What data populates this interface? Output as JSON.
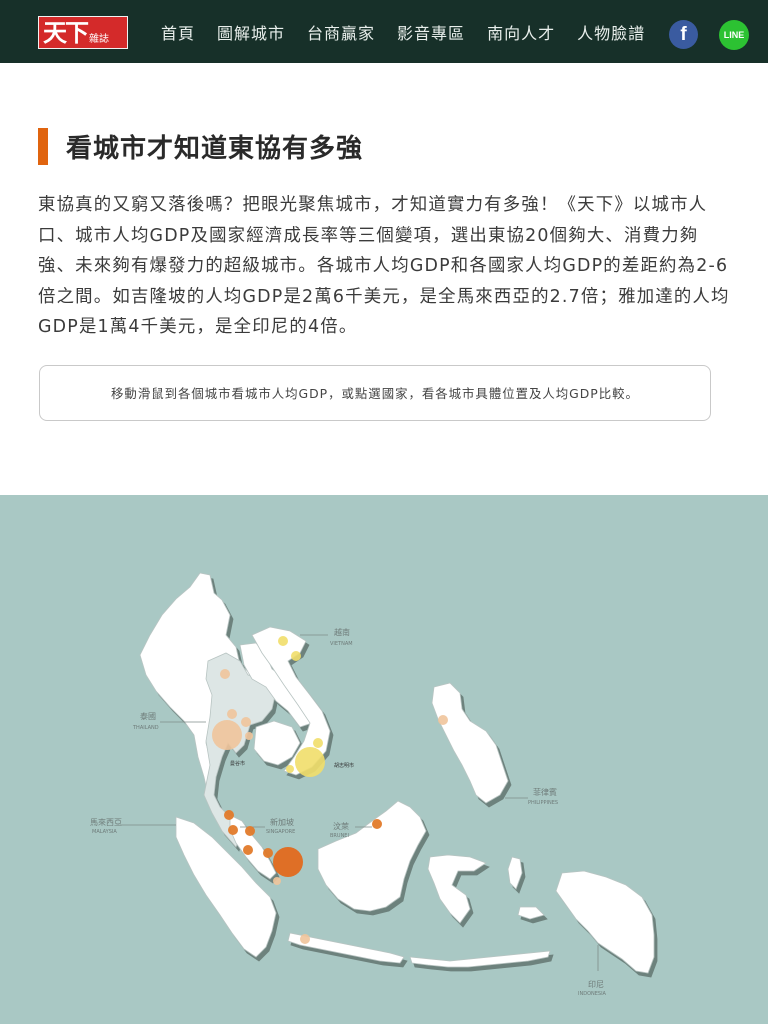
{
  "header": {
    "logo_text": "天下",
    "logo_sub": "雜誌",
    "nav": [
      "首頁",
      "圖解城市",
      "台商贏家",
      "影音專區",
      "南向人才",
      "人物臉譜"
    ],
    "facebook_glyph": "f",
    "line_label": "LINE",
    "icons": [
      "facebook-icon",
      "line-icon"
    ],
    "background_color": "#173029"
  },
  "article": {
    "title": "看城市才知道東協有多強",
    "intro": "東協真的又窮又落後嗎？把眼光聚焦城市，才知道實力有多強！《天下》以城市人口、城市人均GDP及國家經濟成長率等三個變項，選出東協20個夠大、消費力夠強、未來夠有爆發力的超級城市。各城市人均GDP和各國家人均GDP的差距約為2-6倍之間。如吉隆坡的人均GDP是2萬6千美元，是全馬來西亞的2.7倍；雅加達的人均GDP是1萬4千美元，是全印尼的4倍。",
    "hint": "移動滑鼠到各個城市看城市人均GDP，或點選國家，看各城市具體位置及人均GDP比較。",
    "accent_color": "#e0640f"
  },
  "map": {
    "background_color": "#a9c8c4",
    "countries": [
      {
        "name": "越南",
        "en": "VIETNAM"
      },
      {
        "name": "泰國",
        "en": "THAILAND"
      },
      {
        "name": "菲律賓",
        "en": "PHILIPPINES"
      },
      {
        "name": "馬來西亞",
        "en": "MALAYSIA"
      },
      {
        "name": "新加坡",
        "en": "SINGAPORE"
      },
      {
        "name": "汶萊",
        "en": "BRUNEI"
      },
      {
        "name": "印尼",
        "en": "INDONESIA"
      }
    ],
    "cities": [
      "曼谷市",
      "胡志明市"
    ]
  }
}
